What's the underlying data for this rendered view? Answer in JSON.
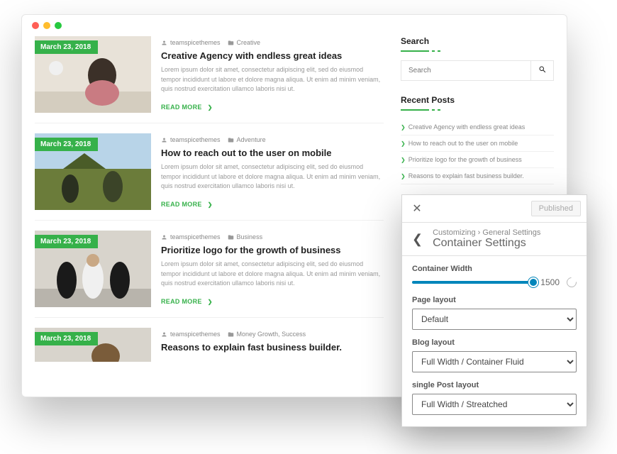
{
  "posts": [
    {
      "date": "March 23, 2018",
      "author": "teamspicethemes",
      "category": "Creative",
      "title": "Creative Agency with endless great ideas",
      "excerpt": "Lorem ipsum dolor sit amet, consectetur adipiscing elit, sed do eiusmod tempor incididunt ut labore et dolore magna aliqua. Ut enim ad minim veniam, quis nostrud exercitation ullamco laboris nisi ut.",
      "readmore": "READ MORE"
    },
    {
      "date": "March 23, 2018",
      "author": "teamspicethemes",
      "category": "Adventure",
      "title": "How to reach out to the user on mobile",
      "excerpt": "Lorem ipsum dolor sit amet, consectetur adipiscing elit, sed do eiusmod tempor incididunt ut labore et dolore magna aliqua. Ut enim ad minim veniam, quis nostrud exercitation ullamco laboris nisi ut.",
      "readmore": "READ MORE"
    },
    {
      "date": "March 23, 2018",
      "author": "teamspicethemes",
      "category": "Business",
      "title": "Prioritize logo for the growth of business",
      "excerpt": "Lorem ipsum dolor sit amet, consectetur adipiscing elit, sed do eiusmod tempor incididunt ut labore et dolore magna aliqua. Ut enim ad minim veniam, quis nostrud exercitation ullamco laboris nisi ut.",
      "readmore": "READ MORE"
    },
    {
      "date": "March 23, 2018",
      "author": "teamspicethemes",
      "category": "Money Growth, Success",
      "title": "Reasons to explain fast business builder.",
      "excerpt": "",
      "readmore": ""
    }
  ],
  "sidebar": {
    "search_title": "Search",
    "search_placeholder": "Search",
    "recent_title": "Recent Posts",
    "recent": [
      "Creative Agency with endless great ideas",
      "How to reach out to the user on mobile",
      "Prioritize logo for the growth of business",
      "Reasons to explain fast business builder."
    ]
  },
  "customizer": {
    "published": "Published",
    "crumbs_1": "Customizing",
    "crumbs_2": "General Settings",
    "title": "Container Settings",
    "width_label": "Container Width",
    "width_value": "1500",
    "page_label": "Page layout",
    "page_value": "Default",
    "blog_label": "Blog layout",
    "blog_value": "Full Width / Container Fluid",
    "single_label": "single Post layout",
    "single_value": "Full Width / Streatched"
  }
}
